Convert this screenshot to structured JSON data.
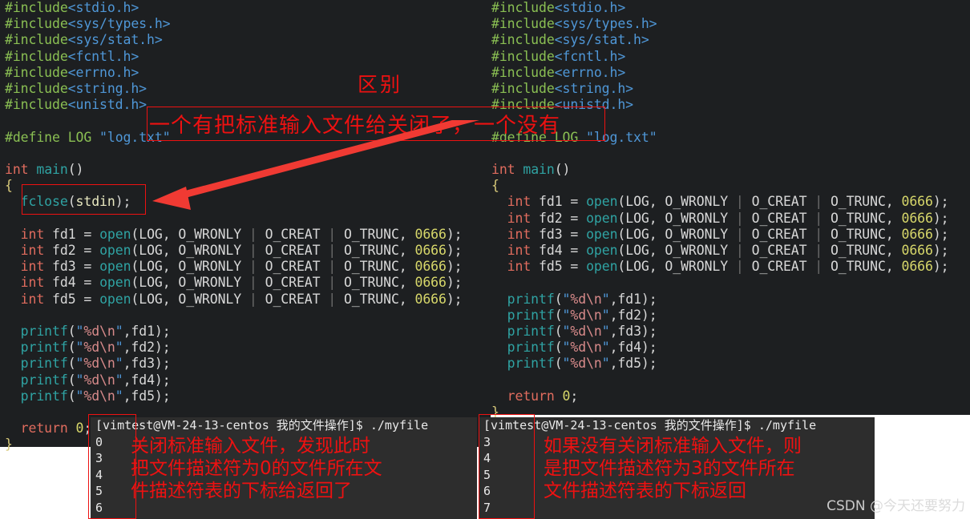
{
  "left_pane": {
    "lines": [
      "#include<stdio.h>",
      "#include<sys/types.h>",
      "#include<sys/stat.h>",
      "#include<fcntl.h>",
      "#include<errno.h>",
      "#include<string.h>",
      "#include<unistd.h>",
      "",
      "#define LOG \"log.txt\"",
      "",
      "int main()",
      "{",
      "  fclose(stdin);",
      "",
      "  int fd1 = open(LOG, O_WRONLY | O_CREAT | O_TRUNC, 0666);",
      "  int fd2 = open(LOG, O_WRONLY | O_CREAT | O_TRUNC, 0666);",
      "  int fd3 = open(LOG, O_WRONLY | O_CREAT | O_TRUNC, 0666);",
      "  int fd4 = open(LOG, O_WRONLY | O_CREAT | O_TRUNC, 0666);",
      "  int fd5 = open(LOG, O_WRONLY | O_CREAT | O_TRUNC, 0666);",
      "",
      "  printf(\"%d\\n\",fd1);",
      "  printf(\"%d\\n\",fd2);",
      "  printf(\"%d\\n\",fd3);",
      "  printf(\"%d\\n\",fd4);",
      "  printf(\"%d\\n\",fd5);",
      "",
      "  return 0;",
      "}"
    ]
  },
  "right_pane": {
    "lines": [
      "#include<stdio.h>",
      "#include<sys/types.h>",
      "#include<sys/stat.h>",
      "#include<fcntl.h>",
      "#include<errno.h>",
      "#include<string.h>",
      "#include<unistd.h>",
      "",
      "#define LOG \"log.txt\"",
      "",
      "int main()",
      "{",
      "  int fd1 = open(LOG, O_WRONLY | O_CREAT | O_TRUNC, 0666);",
      "  int fd2 = open(LOG, O_WRONLY | O_CREAT | O_TRUNC, 0666);",
      "  int fd3 = open(LOG, O_WRONLY | O_CREAT | O_TRUNC, 0666);",
      "  int fd4 = open(LOG, O_WRONLY | O_CREAT | O_TRUNC, 0666);",
      "  int fd5 = open(LOG, O_WRONLY | O_CREAT | O_TRUNC, 0666);",
      "",
      "  printf(\"%d\\n\",fd1);",
      "  printf(\"%d\\n\",fd2);",
      "  printf(\"%d\\n\",fd3);",
      "  printf(\"%d\\n\",fd4);",
      "  printf(\"%d\\n\",fd5);",
      "",
      "  return 0;",
      "}"
    ]
  },
  "terminal_left": {
    "prompt": "[vimtest@VM-24-13-centos 我的文件操作]$ ./myfile",
    "output": [
      "0",
      "3",
      "4",
      "5",
      "6"
    ]
  },
  "terminal_right": {
    "prompt": "[vimtest@VM-24-13-centos 我的文件操作]$ ./myfile",
    "output": [
      "3",
      "4",
      "5",
      "6",
      "7"
    ]
  },
  "annotations": {
    "diff_label": "区别",
    "diff_text": "一个有把标准输入文件给关闭了，一个没有",
    "note_left": "关闭标准输入文件，发现此时\n把文件描述符为0的文件所在文\n件描述符表的下标给返回了",
    "note_right": "如果没有关闭标准输入文件，则\n是把文件描述符为3的文件所在\n文件描述符表的下标返回",
    "red_color": "#ee1111"
  },
  "watermark": "CSDN @今天还要努力"
}
